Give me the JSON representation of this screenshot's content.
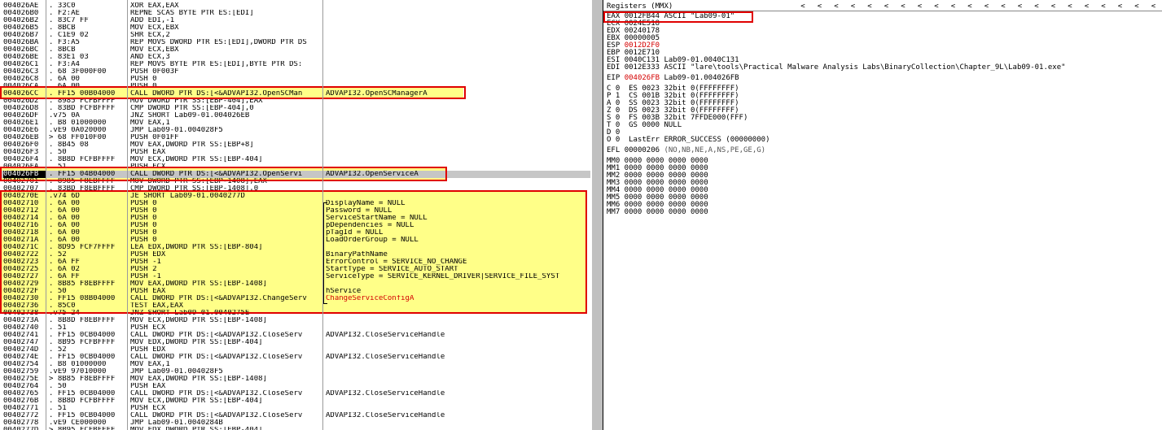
{
  "disasm": {
    "rows": [
      {
        "addr": "004026AE",
        "hex": ". 33C0",
        "asm": "XOR EAX,EAX",
        "comment": ""
      },
      {
        "addr": "004026B0",
        "hex": ". F2:AE",
        "asm": "REPNE SCAS BYTE PTR ES:[EDI]",
        "comment": ""
      },
      {
        "addr": "004026B2",
        "hex": ". 83C7 FF",
        "asm": "ADD EDI,-1",
        "comment": ""
      },
      {
        "addr": "004026B5",
        "hex": ". 8BCB",
        "asm": "MOV ECX,EBX",
        "comment": ""
      },
      {
        "addr": "004026B7",
        "hex": ". C1E9 02",
        "asm": "SHR ECX,2",
        "comment": ""
      },
      {
        "addr": "004026BA",
        "hex": ". F3:A5",
        "asm": "REP MOVS DWORD PTR ES:[EDI],DWORD PTR DS",
        "comment": ""
      },
      {
        "addr": "004026BC",
        "hex": ". 8BCB",
        "asm": "MOV ECX,EBX",
        "comment": ""
      },
      {
        "addr": "004026BE",
        "hex": ". 83E1 03",
        "asm": "AND ECX,3",
        "comment": ""
      },
      {
        "addr": "004026C1",
        "hex": ". F3:A4",
        "asm": "REP MOVS BYTE PTR ES:[EDI],BYTE PTR DS:",
        "comment": ""
      },
      {
        "addr": "004026C3",
        "hex": ". 68 3F000F00",
        "asm": "PUSH 0F003F",
        "comment": ""
      },
      {
        "addr": "004026C8",
        "hex": ". 6A 00",
        "asm": "PUSH 0",
        "comment": ""
      },
      {
        "addr": "004026CA",
        "hex": ". 6A 00",
        "asm": "PUSH 0",
        "comment": ""
      },
      {
        "addr": "004026CC",
        "hex": ". FF15 00B04000",
        "asm": "CALL DWORD PTR DS:[<&ADVAPI32.OpenSCMan",
        "comment": "ADVAPI32.OpenSCManagerA"
      },
      {
        "addr": "004026D2",
        "hex": ". 8985 FCFBFFFF",
        "asm": "MOV DWORD PTR SS:[EBP-404],EAX",
        "comment": ""
      },
      {
        "addr": "004026D8",
        "hex": ". 83BD FCFBFFFF",
        "asm": "CMP DWORD PTR SS:[EBP-404],0",
        "comment": ""
      },
      {
        "addr": "004026DF",
        "hex": ".v75 0A",
        "asm": "JNZ SHORT Lab09-01.004026EB",
        "comment": ""
      },
      {
        "addr": "004026E1",
        "hex": ". B8 01000000",
        "asm": "MOV EAX,1",
        "comment": ""
      },
      {
        "addr": "004026E6",
        "hex": ".vE9 0A020000",
        "asm": "JMP Lab09-01.004028F5",
        "comment": ""
      },
      {
        "addr": "004026EB",
        "hex": "> 68 FF010F00",
        "asm": "PUSH 0F01FF",
        "comment": ""
      },
      {
        "addr": "004026F0",
        "hex": ". 8B45 08",
        "asm": "MOV EAX,DWORD PTR SS:[EBP+8]",
        "comment": ""
      },
      {
        "addr": "004026F3",
        "hex": ". 50",
        "asm": "PUSH EAX",
        "comment": ""
      },
      {
        "addr": "004026F4",
        "hex": ". 8B8D FCFBFFFF",
        "asm": "MOV ECX,DWORD PTR SS:[EBP-404]",
        "comment": ""
      },
      {
        "addr": "004026FA",
        "hex": ". 51",
        "asm": "PUSH ECX",
        "comment": ""
      },
      {
        "addr": "004026FB",
        "hex": ". FF15 04B04000",
        "asm": "CALL DWORD PTR DS:[<&ADVAPI32.OpenServi",
        "comment": "ADVAPI32.OpenServiceA"
      },
      {
        "addr": "00402701",
        "hex": ". 8985 F8EBFFFF",
        "asm": "MOV DWORD PTR SS:[EBP-1408],EAX",
        "comment": ""
      },
      {
        "addr": "00402707",
        "hex": ". 83BD F8EBFFFF",
        "asm": "CMP DWORD PTR SS:[EBP-1408],0",
        "comment": ""
      },
      {
        "addr": "0040270E",
        "hex": ".v74 6D",
        "asm": "JE SHORT Lab09-01.0040277D",
        "comment": ""
      },
      {
        "addr": "00402710",
        "hex": ". 6A 00",
        "asm": "PUSH 0",
        "comment": "DisplayName = NULL"
      },
      {
        "addr": "00402712",
        "hex": ". 6A 00",
        "asm": "PUSH 0",
        "comment": "Password = NULL"
      },
      {
        "addr": "00402714",
        "hex": ". 6A 00",
        "asm": "PUSH 0",
        "comment": "ServiceStartName = NULL"
      },
      {
        "addr": "00402716",
        "hex": ". 6A 00",
        "asm": "PUSH 0",
        "comment": "pDependencies = NULL"
      },
      {
        "addr": "00402718",
        "hex": ". 6A 00",
        "asm": "PUSH 0",
        "comment": "pTagId = NULL"
      },
      {
        "addr": "0040271A",
        "hex": ". 6A 00",
        "asm": "PUSH 0",
        "comment": "LoadOrderGroup = NULL"
      },
      {
        "addr": "0040271C",
        "hex": ". 8D95 FCF7FFFF",
        "asm": "LEA EDX,DWORD PTR SS:[EBP-804]",
        "comment": ""
      },
      {
        "addr": "00402722",
        "hex": ". 52",
        "asm": "PUSH EDX",
        "comment": "BinaryPathName"
      },
      {
        "addr": "00402723",
        "hex": ". 6A FF",
        "asm": "PUSH -1",
        "comment": "ErrorControl = SERVICE_NO_CHANGE"
      },
      {
        "addr": "00402725",
        "hex": ". 6A 02",
        "asm": "PUSH 2",
        "comment": "StartType = SERVICE_AUTO_START"
      },
      {
        "addr": "00402727",
        "hex": ". 6A FF",
        "asm": "PUSH -1",
        "comment": "ServiceType = SERVICE_KERNEL_DRIVER|SERVICE_FILE_SYST"
      },
      {
        "addr": "00402729",
        "hex": ". 8B85 F8EBFFFF",
        "asm": "MOV EAX,DWORD PTR SS:[EBP-1408]",
        "comment": ""
      },
      {
        "addr": "0040272F",
        "hex": ". 50",
        "asm": "PUSH EAX",
        "comment": "hService"
      },
      {
        "addr": "00402730",
        "hex": ". FF15 08B04000",
        "asm": "CALL DWORD PTR DS:[<&ADVAPI32.ChangeServ",
        "comment": "ChangeServiceConfigA"
      },
      {
        "addr": "00402736",
        "hex": ". 85C0",
        "asm": "TEST EAX,EAX",
        "comment": ""
      },
      {
        "addr": "00402738",
        "hex": ".v75 24",
        "asm": "JNZ SHORT Lab09-01.0040275E",
        "comment": ""
      },
      {
        "addr": "0040273A",
        "hex": ". 8B8D F8EBFFFF",
        "asm": "MOV ECX,DWORD PTR SS:[EBP-1408]",
        "comment": ""
      },
      {
        "addr": "00402740",
        "hex": ". 51",
        "asm": "PUSH ECX",
        "comment": ""
      },
      {
        "addr": "00402741",
        "hex": ". FF15 0CB04000",
        "asm": "CALL DWORD PTR DS:[<&ADVAPI32.CloseServ",
        "comment": "ADVAPI32.CloseServiceHandle"
      },
      {
        "addr": "00402747",
        "hex": ". 8B95 FCFBFFFF",
        "asm": "MOV EDX,DWORD PTR SS:[EBP-404]",
        "comment": ""
      },
      {
        "addr": "0040274D",
        "hex": ". 52",
        "asm": "PUSH EDX",
        "comment": ""
      },
      {
        "addr": "0040274E",
        "hex": ". FF15 0CB04000",
        "asm": "CALL DWORD PTR DS:[<&ADVAPI32.CloseServ",
        "comment": "ADVAPI32.CloseServiceHandle"
      },
      {
        "addr": "00402754",
        "hex": ". B8 01000000",
        "asm": "MOV EAX,1",
        "comment": ""
      },
      {
        "addr": "00402759",
        "hex": ".vE9 97010000",
        "asm": "JMP Lab09-01.004028F5",
        "comment": ""
      },
      {
        "addr": "0040275E",
        "hex": "> 8B85 F8EBFFFF",
        "asm": "MOV EAX,DWORD PTR SS:[EBP-1408]",
        "comment": ""
      },
      {
        "addr": "00402764",
        "hex": ". 50",
        "asm": "PUSH EAX",
        "comment": ""
      },
      {
        "addr": "00402765",
        "hex": ". FF15 0CB04000",
        "asm": "CALL DWORD PTR DS:[<&ADVAPI32.CloseServ",
        "comment": "ADVAPI32.CloseServiceHandle"
      },
      {
        "addr": "0040276B",
        "hex": ". 8B8D FCFBFFFF",
        "asm": "MOV ECX,DWORD PTR SS:[EBP-404]",
        "comment": ""
      },
      {
        "addr": "00402771",
        "hex": ". 51",
        "asm": "PUSH ECX",
        "comment": ""
      },
      {
        "addr": "00402772",
        "hex": ". FF15 0CB04000",
        "asm": "CALL DWORD PTR DS:[<&ADVAPI32.CloseServ",
        "comment": "ADVAPI32.CloseServiceHandle"
      },
      {
        "addr": "00402778",
        "hex": ".vE9 CE000000",
        "asm": "JMP Lab09-01.0040284B",
        "comment": ""
      },
      {
        "addr": "0040277D",
        "hex": "> 8B95 FCFBFFFF",
        "asm": "MOV EDX,DWORD PTR SS:[EBP-404]",
        "comment": ""
      }
    ],
    "selected_row": 23,
    "red_comment_row": 40
  },
  "registers": {
    "title": "Registers (MMX)",
    "arrows": [
      "<",
      "<",
      "<",
      "<",
      "<",
      "<",
      "<",
      "<",
      "<",
      "<",
      "<",
      "<",
      "<",
      "<",
      "<",
      "<",
      "<",
      "<",
      "<",
      "<",
      "<",
      "<"
    ],
    "rows": [
      {
        "name": "EAX",
        "value": "0012FB44",
        "note": "ASCII \"Lab09-01\"",
        "red": false
      },
      {
        "name": "ECX",
        "value": "0024E518",
        "note": "",
        "red": false
      },
      {
        "name": "EDX",
        "value": "00240178",
        "note": "",
        "red": false
      },
      {
        "name": "EBX",
        "value": "00000005",
        "note": "",
        "red": false
      },
      {
        "name": "ESP",
        "value": "0012D2F0",
        "note": "",
        "red": true
      },
      {
        "name": "EBP",
        "value": "0012E710",
        "note": "",
        "red": false
      },
      {
        "name": "ESI",
        "value": "0040C131",
        "note": "Lab09-01.0040C131",
        "red": false
      },
      {
        "name": "EDI",
        "value": "0012E333",
        "note": "ASCII \"lare\\tools\\Practical Malware Analysis Labs\\BinaryCollection\\Chapter_9L\\Lab09-01.exe\"",
        "red": false
      }
    ],
    "eip": {
      "name": "EIP",
      "value": "004026FB",
      "note": "Lab09-01.004026FB"
    },
    "flags": [
      "C 0  ES 0023 32bit 0(FFFFFFFF)",
      "P 1  CS 001B 32bit 0(FFFFFFFF)",
      "A 0  SS 0023 32bit 0(FFFFFFFF)",
      "Z 0  DS 0023 32bit 0(FFFFFFFF)",
      "S 0  FS 003B 32bit 7FFDE000(FFF)",
      "T 0  GS 0000 NULL",
      "D 0",
      "O 0  LastErr ERROR_SUCCESS (00000000)"
    ],
    "efl": {
      "label": "EFL",
      "value": "00000206",
      "flags": "(NO,NB,NE,A,NS,PE,GE,G)"
    },
    "mmx": [
      "MM0 0000 0000 0000 0000",
      "MM1 0000 0000 0000 0000",
      "MM2 0000 0000 0000 0000",
      "MM3 0000 0000 0000 0000",
      "MM4 0000 0000 0000 0000",
      "MM5 0000 0000 0000 0000",
      "MM6 0000 0000 0000 0000",
      "MM7 0000 0000 0000 0000"
    ]
  },
  "colors": {
    "highlight": "#ffff88",
    "annotation": "#e00000",
    "selection": "#000000"
  }
}
